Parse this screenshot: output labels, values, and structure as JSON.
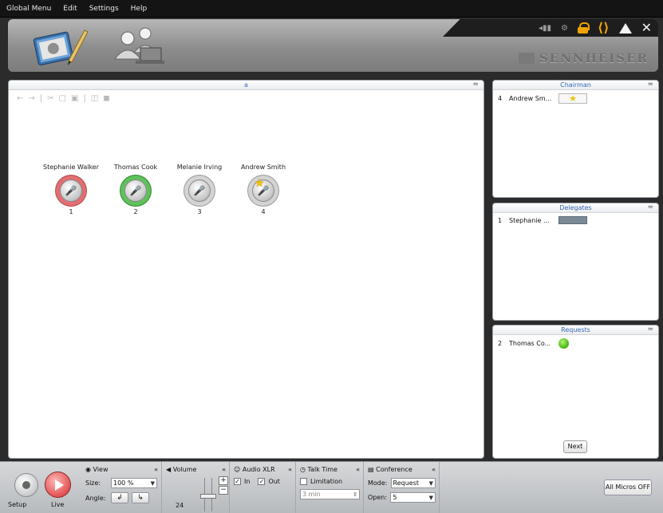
{
  "menu": [
    "Global Menu",
    "Edit",
    "Settings",
    "Help"
  ],
  "brand": "SENNHEISER",
  "main_panel": {
    "title": "a",
    "seats": [
      {
        "name": "Stephanie Walker",
        "number": "1",
        "state": "red"
      },
      {
        "name": "Thomas Cook",
        "number": "2",
        "state": "green"
      },
      {
        "name": "Melanie Irving",
        "number": "3",
        "state": "off"
      },
      {
        "name": "Andrew Smith",
        "number": "4",
        "state": "chairman"
      }
    ]
  },
  "chairman_panel": {
    "title": "Chairman",
    "rows": [
      {
        "num": "4",
        "name": "Andrew Sm..."
      }
    ]
  },
  "delegates_panel": {
    "title": "Delegates",
    "rows": [
      {
        "num": "1",
        "name": "Stephanie ..."
      }
    ]
  },
  "requests_panel": {
    "title": "Requests",
    "rows": [
      {
        "num": "2",
        "name": "Thomas Co..."
      }
    ],
    "next_label": "Next"
  },
  "bottom": {
    "setup_label": "Setup",
    "live_label": "Live",
    "view": {
      "title": "View",
      "size_label": "Size:",
      "size_value": "100 %",
      "angle_label": "Angle:"
    },
    "volume": {
      "title": "Volume",
      "value": "24"
    },
    "audio": {
      "title": "Audio XLR",
      "in_label": "In",
      "out_label": "Out"
    },
    "talk": {
      "title": "Talk Time",
      "limitation_label": "Limitation",
      "time_value": "3 min"
    },
    "conference": {
      "title": "Conference",
      "mode_label": "Mode:",
      "mode_value": "Request",
      "open_label": "Open:",
      "open_value": "5"
    },
    "all_off_label": "All Micros OFF"
  }
}
